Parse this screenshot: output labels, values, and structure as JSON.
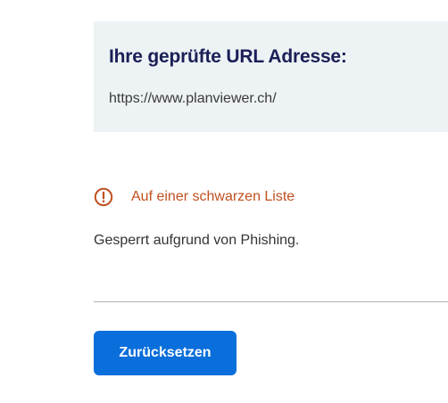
{
  "url_check": {
    "title": "Ihre geprüfte URL Adresse:",
    "url": "https://www.planviewer.ch/"
  },
  "status": {
    "icon": "warning-circle-icon",
    "label": "Auf einer schwarzen Liste",
    "color": "#c0501f"
  },
  "reason": "Gesperrt aufgrund von Phishing.",
  "actions": {
    "reset_label": "Zurücksetzen",
    "reset_color": "#0a6edb"
  },
  "colors": {
    "title": "#1a1f56",
    "box_background": "#edf2f5"
  }
}
